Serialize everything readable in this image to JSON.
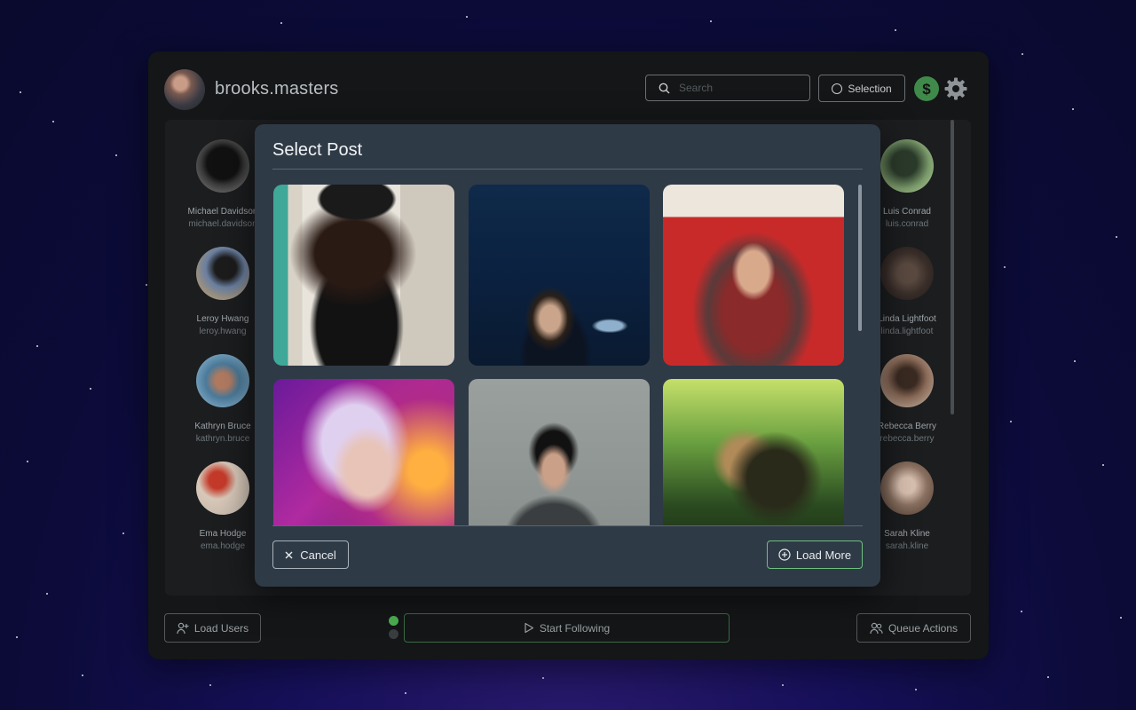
{
  "header": {
    "username": "brooks.masters",
    "search_placeholder": "Search",
    "selection_label": "Selection"
  },
  "users_left": [
    {
      "name": "Michael Davidson",
      "handle": "michael.davidson"
    },
    {
      "name": "Leroy Hwang",
      "handle": "leroy.hwang"
    },
    {
      "name": "Kathryn Bruce",
      "handle": "kathryn.bruce"
    },
    {
      "name": "Ema Hodge",
      "handle": "ema.hodge"
    }
  ],
  "users_right": [
    {
      "name": "Luis Conrad",
      "handle": "luis.conrad"
    },
    {
      "name": "Linda Lightfoot",
      "handle": "linda.lightfoot"
    },
    {
      "name": "Rebecca Berry",
      "handle": "rebecca.berry"
    },
    {
      "name": "Sarah Kline",
      "handle": "sarah.kline"
    }
  ],
  "footer": {
    "load_users": "Load Users",
    "start_following": "Start Following",
    "queue_actions": "Queue Actions"
  },
  "modal": {
    "title": "Select Post",
    "cancel": "Cancel",
    "load_more": "Load More"
  },
  "colors": {
    "accent_green": "#3f8a4a",
    "modal_bg": "#2f3a47",
    "app_bg": "#141617"
  }
}
